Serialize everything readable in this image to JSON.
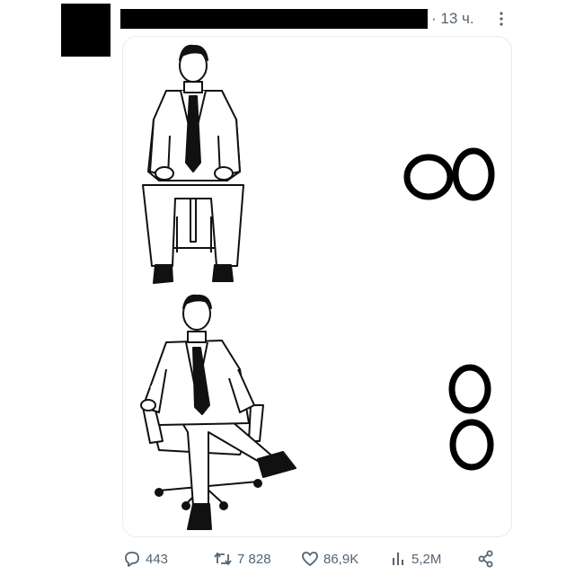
{
  "post": {
    "time": "13 ч.",
    "separator": "·"
  },
  "media": {
    "top_symbol": "oo",
    "bottom_symbol": "8"
  },
  "actions": {
    "replies": "443",
    "reposts": "7 828",
    "likes": "86,9K",
    "views": "5,2M"
  },
  "icons": {
    "reply": "speech-bubble-icon",
    "repost": "repost-arrows-icon",
    "like": "heart-icon",
    "views": "bar-chart-icon",
    "share": "share-icon",
    "more": "more-dots-icon"
  },
  "colors": {
    "muted_text": "#536471",
    "border": "#e7ebee",
    "redaction": "#000000"
  }
}
